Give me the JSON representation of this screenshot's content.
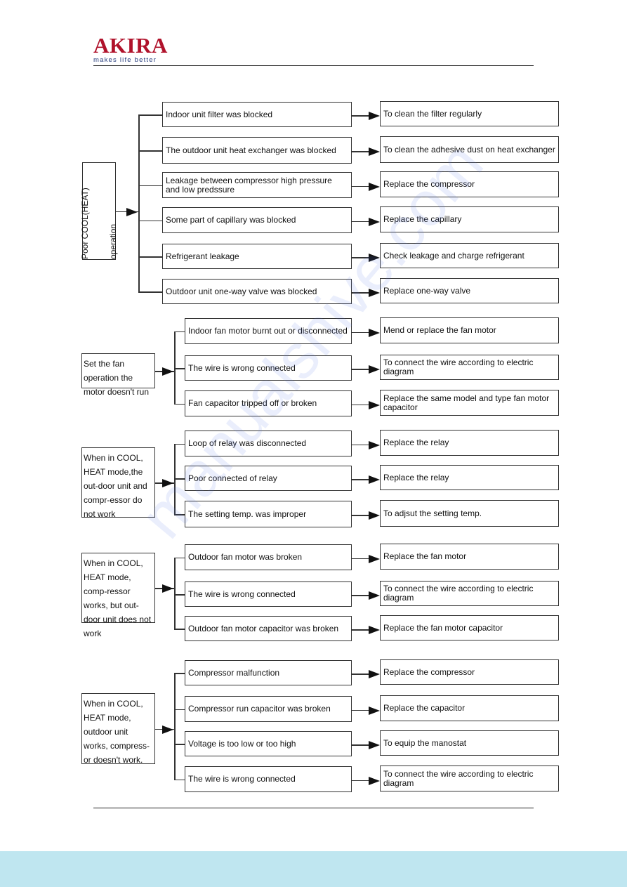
{
  "header": {
    "brand": "AKIRA",
    "tagline": "makes life better",
    "brand_color": "#b0122b"
  },
  "watermark": "manualshive.com",
  "groups": [
    {
      "symptom": "Poor COOL(HEAT) operation",
      "items": [
        {
          "cause": "Indoor unit filter was blocked",
          "remedy": "To clean the filter regularly"
        },
        {
          "cause": "The outdoor unit heat exchanger was blocked",
          "remedy": "To clean the adhesive dust on heat exchanger"
        },
        {
          "cause": "Leakage between compressor high pressure and low predssure",
          "remedy": "Replace the compressor"
        },
        {
          "cause": "Some part of capillary was blocked",
          "remedy": "Replace the capillary"
        },
        {
          "cause": "Refrigerant leakage",
          "remedy": "Check leakage and charge refrigerant"
        },
        {
          "cause": "Outdoor unit one-way valve was blocked",
          "remedy": "Replace one-way valve"
        }
      ]
    },
    {
      "symptom": "Set the fan operation the motor doesn't run",
      "items": [
        {
          "cause": "Indoor fan motor burnt out or disconnected",
          "remedy": "Mend or replace the fan motor"
        },
        {
          "cause": "The wire is wrong connected",
          "remedy": "To connect the wire according to electric diagram"
        },
        {
          "cause": "Fan capacitor tripped off or broken",
          "remedy": "Replace the same model and type fan motor capacitor"
        }
      ]
    },
    {
      "symptom": "When in COOL, HEAT mode,the out-door unit and compr-essor do not work",
      "items": [
        {
          "cause": "Loop of relay was disconnected",
          "remedy": "Replace the relay"
        },
        {
          "cause": "Poor connected of relay",
          "remedy": "Replace the relay"
        },
        {
          "cause": "The setting temp. was improper",
          "remedy": "To adjsut the setting temp."
        }
      ]
    },
    {
      "symptom": "When in COOL, HEAT mode, comp-ressor works, but out-door unit does not work",
      "items": [
        {
          "cause": "Outdoor  fan motor was broken",
          "remedy": "Replace the fan motor"
        },
        {
          "cause": "The wire is wrong connected",
          "remedy": "To connect the wire according to electric diagram"
        },
        {
          "cause": "Outdoor fan motor capacitor was broken",
          "remedy": "Replace the  fan motor capacitor"
        }
      ]
    },
    {
      "symptom": "When in COOL, HEAT mode, outdoor unit works, compress-or doesn't work.",
      "items": [
        {
          "cause": "Compressor malfunction",
          "remedy": "Replace the compressor"
        },
        {
          "cause": "Compressor run capacitor was broken",
          "remedy": "Replace the  capacitor"
        },
        {
          "cause": "Voltage is too low or too high",
          "remedy": "To equip the manostat"
        },
        {
          "cause": "The wire is wrong connected",
          "remedy": "To connect the wire according to electric diagram"
        }
      ]
    }
  ]
}
